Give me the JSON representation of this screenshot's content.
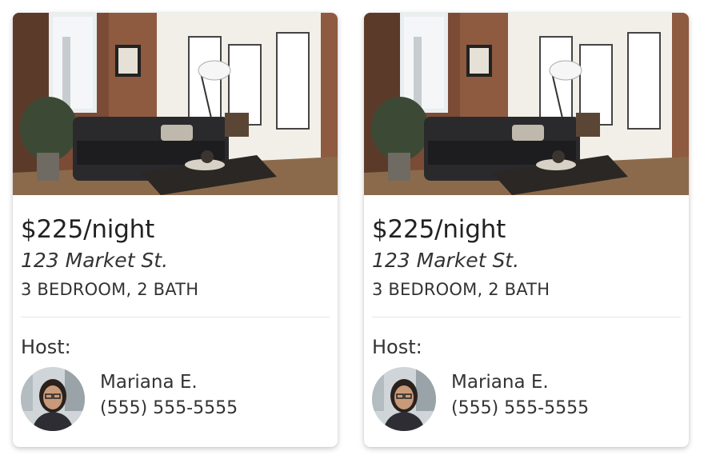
{
  "listings": [
    {
      "price": "$225/night",
      "address": "123 Market St.",
      "rooms": "3 BEDROOM, 2 BATH",
      "host_label": "Host:",
      "host_name": "Mariana E.",
      "host_phone": "(555) 555-5555"
    },
    {
      "price": "$225/night",
      "address": "123 Market St.",
      "rooms": "3 BEDROOM, 2 BATH",
      "host_label": "Host:",
      "host_name": "Mariana E.",
      "host_phone": "(555) 555-5555"
    }
  ]
}
